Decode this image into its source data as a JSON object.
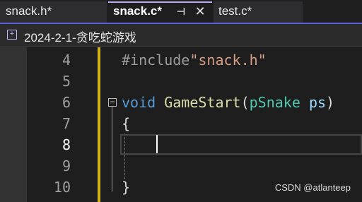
{
  "tabs": [
    {
      "label": "snack.h*"
    },
    {
      "label": "snack.c*",
      "active": true
    },
    {
      "label": "test.c*"
    }
  ],
  "icons": {
    "pin": "pin-icon",
    "close": "close-icon",
    "project": "project-icon",
    "fold": "collapse-icon"
  },
  "project": {
    "name": "2024-2-1-贪吃蛇游戏"
  },
  "editor": {
    "line_numbers": [
      "4",
      "5",
      "6",
      "7",
      "8",
      "9",
      "10"
    ],
    "current_line": "8",
    "lines": {
      "l4": {
        "directive": "#include",
        "header": "\"snack.h\""
      },
      "l6": {
        "keyword": "void",
        "function": "GameStart",
        "open_paren": "(",
        "type": "pSnake",
        "param": "ps",
        "close_paren": ")"
      },
      "l7": {
        "text": "{"
      },
      "l10": {
        "text": "}"
      }
    }
  },
  "watermark": "CSDN @atlanteep",
  "colors": {
    "accent": "#5b5be0",
    "modified_bar": "#d1b11a",
    "keyword": "#569cd6",
    "function": "#dcdcaa",
    "type": "#4ec9b0",
    "string": "#d69d85"
  }
}
